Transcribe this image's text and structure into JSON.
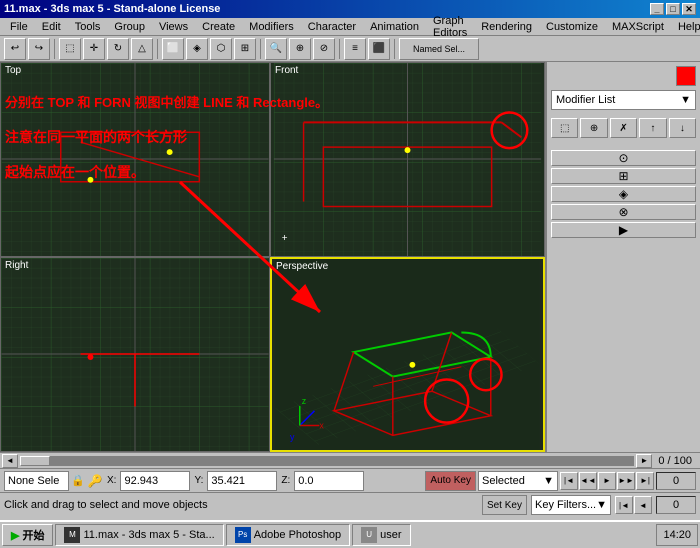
{
  "titleBar": {
    "title": "11.max - 3ds max 5 - Stand-alone License",
    "minimizeLabel": "_",
    "maximizeLabel": "□",
    "closeLabel": "✕"
  },
  "menuBar": {
    "items": [
      "File",
      "Edit",
      "Tools",
      "Group",
      "Views",
      "Create",
      "Modifiers",
      "Character",
      "Animation",
      "Graph Editors",
      "Rendering",
      "Customize",
      "MAXScript",
      "Help"
    ]
  },
  "annotation": {
    "line1": "分别在 TOP 和 FORN 视图中创建 LINE 和 Rectangle。",
    "line2": "注意在同一平面的两个长方形",
    "line3": "起始点应在一个位置。"
  },
  "viewports": {
    "topLabel": "Top",
    "frontLabel": "Front",
    "rightLabel": "Right",
    "perspectiveLabel": "Perspective"
  },
  "rightPanel": {
    "modifierList": "Modifier List",
    "dropdownArrow": "▼"
  },
  "scrollBar": {
    "progress": "0 / 100"
  },
  "statusBar": {
    "noneSelect": "None Sele",
    "xLabel": "X:",
    "xValue": "92.943",
    "yLabel": "Y:",
    "yValue": "35.421",
    "zLabel": "Z:",
    "zValue": "0.0",
    "autoKey": "Auto Key",
    "selectedLabel": "Selected",
    "setKey": "Set Key",
    "keyFilters": "Key Filters...",
    "keyFrameValue": "0",
    "statusText": "Click and drag to select and move objects"
  },
  "taskbar": {
    "startLabel": "开始",
    "item1": "11.max - 3ds max 5 - Sta...",
    "item2": "Adobe Photoshop",
    "item3": "user",
    "time": "14:20"
  }
}
